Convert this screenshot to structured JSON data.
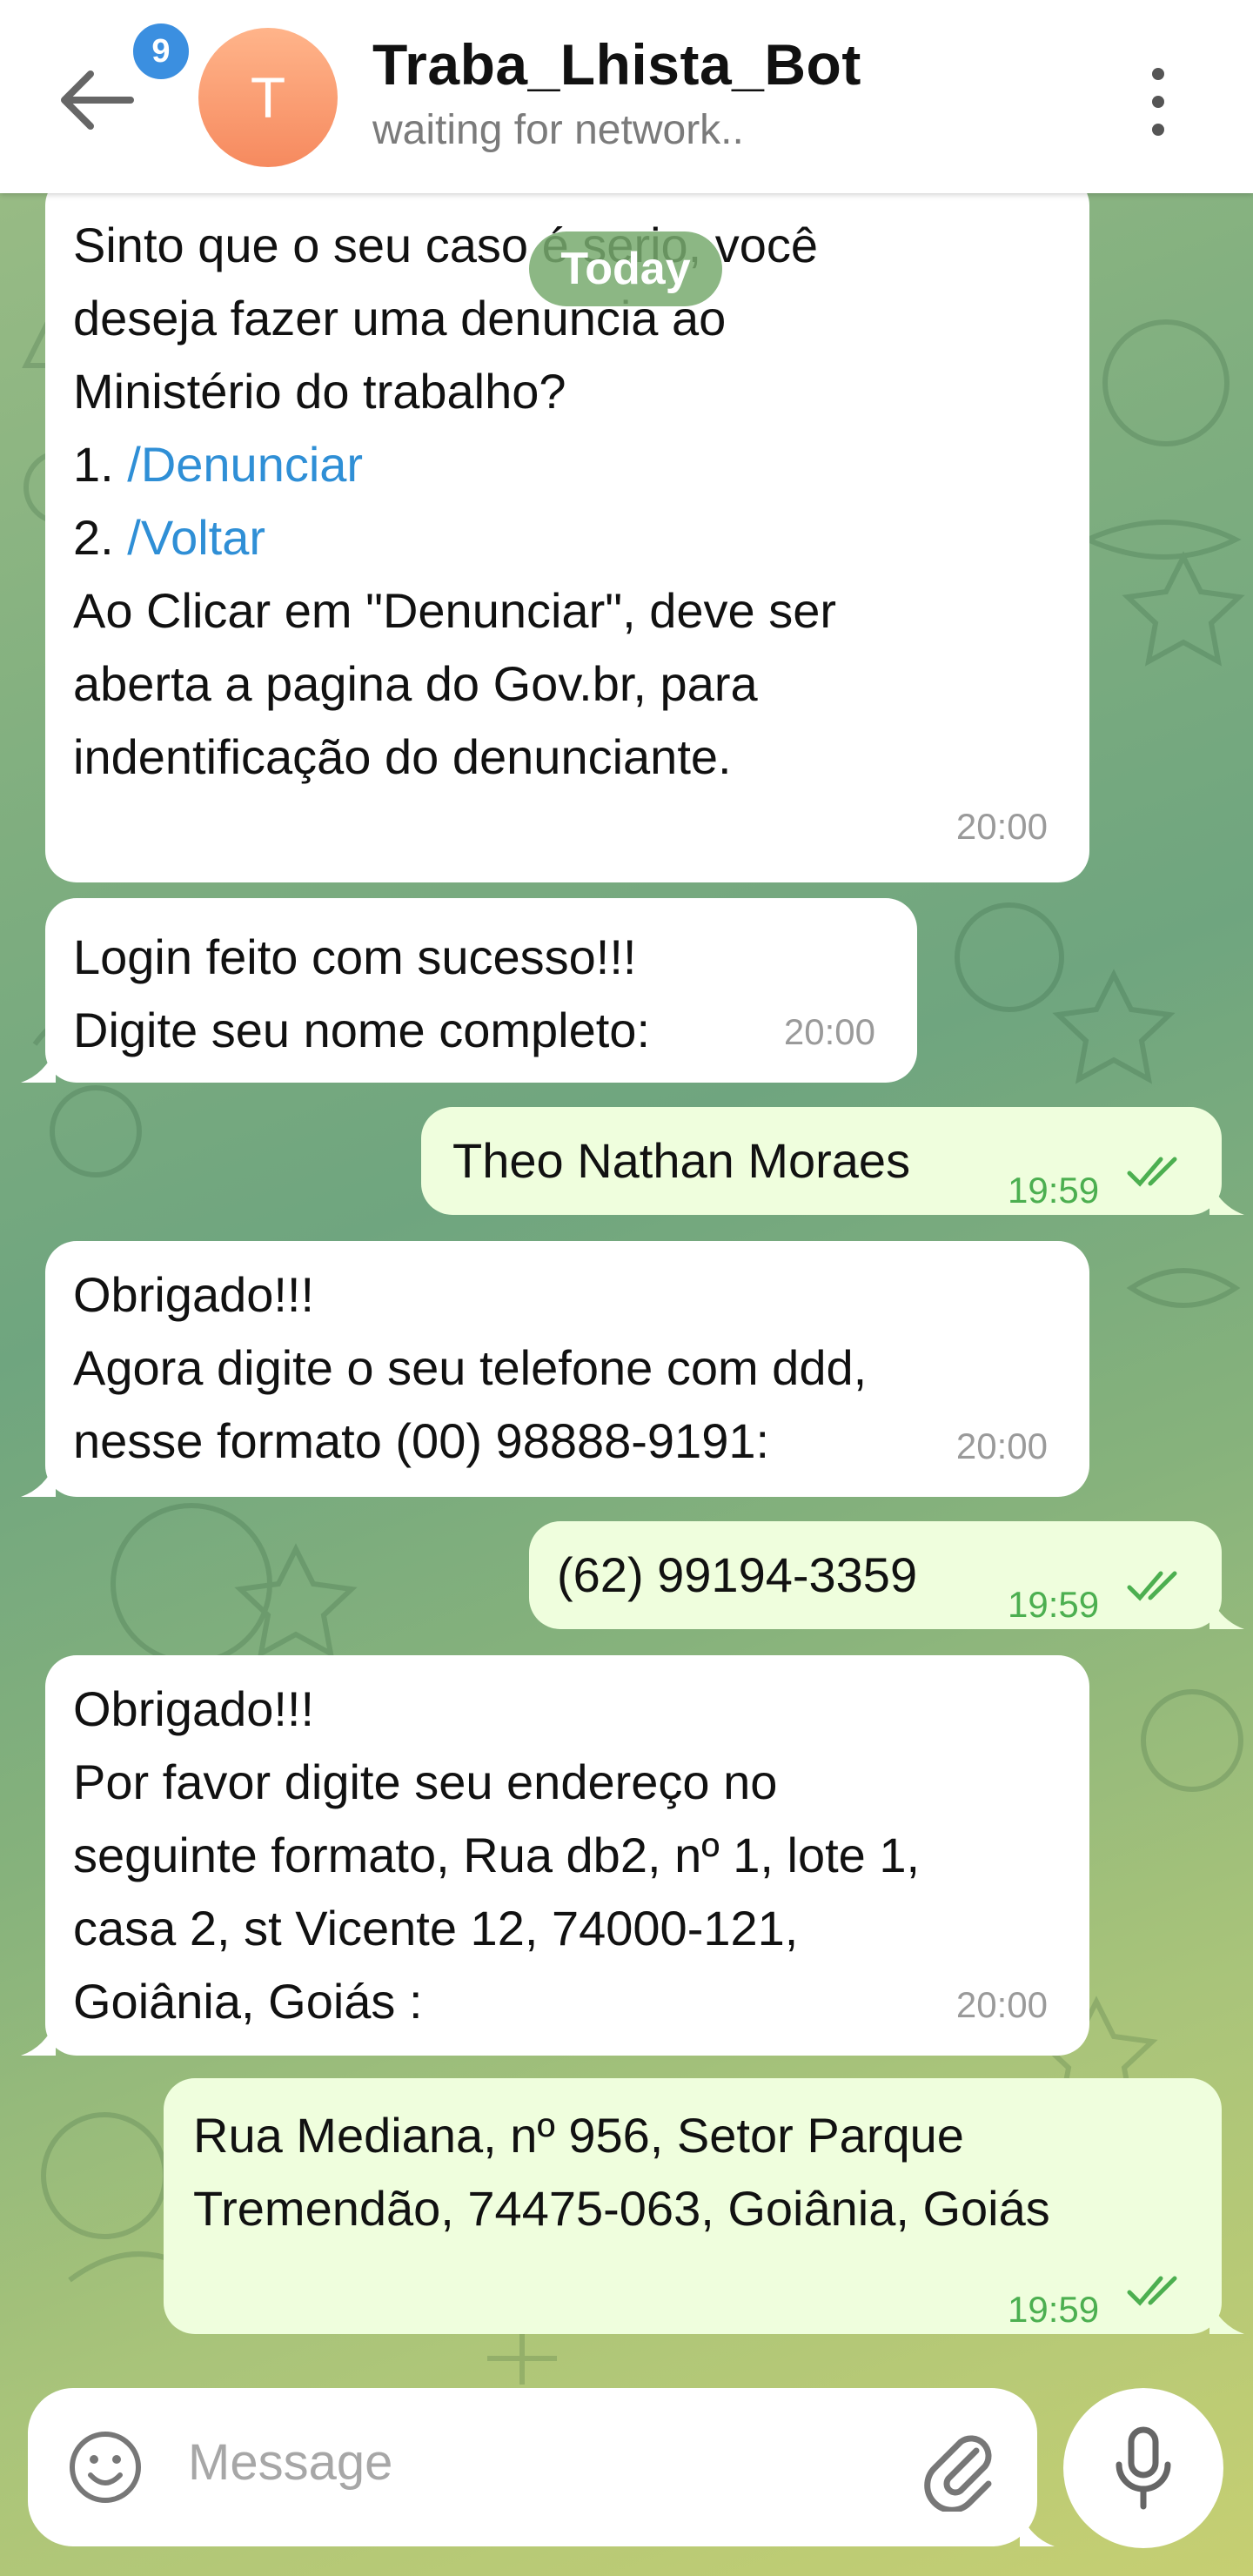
{
  "header": {
    "unread_count": "9",
    "avatar_letter": "T",
    "title": "Traba_Lhista_Bot",
    "status": "waiting for network.."
  },
  "date_label": "Today",
  "messages": [
    {
      "lines": [
        "Sinto que o seu caso é serio, você",
        "deseja fazer uma denuncia ao",
        "Ministério do trabalho?"
      ],
      "option1_num": "1. ",
      "option1_cmd": "/Denunciar",
      "option2_num": "2. ",
      "option2_cmd": "/Voltar",
      "tail_lines": [
        "Ao Clicar em \"Denunciar\", deve ser",
        "aberta a pagina do Gov.br, para",
        "indentificação do denunciante."
      ],
      "time": "20:00"
    },
    {
      "lines": [
        "Login feito com sucesso!!!",
        "Digite seu nome completo:"
      ],
      "time": "20:00"
    },
    {
      "lines": [
        "Theo Nathan Moraes"
      ],
      "time": "19:59"
    },
    {
      "lines": [
        "Obrigado!!!",
        "Agora digite o seu telefone com ddd,",
        "nesse formato (00) 98888-9191:"
      ],
      "time": "20:00"
    },
    {
      "lines": [
        "(62) 99194-3359"
      ],
      "time": "19:59"
    },
    {
      "lines": [
        "Obrigado!!!",
        "Por favor digite seu endereço no",
        "seguinte formato, Rua db2, nº 1, lote 1,",
        "casa 2, st Vicente 12, 74000-121,",
        "Goiânia, Goiás :"
      ],
      "time": "20:00"
    },
    {
      "lines": [
        "Rua Mediana, nº 956, Setor Parque",
        "Tremendão, 74475-063, Goiânia, Goiás"
      ],
      "time": "19:59"
    }
  ],
  "input": {
    "placeholder": "Message"
  }
}
